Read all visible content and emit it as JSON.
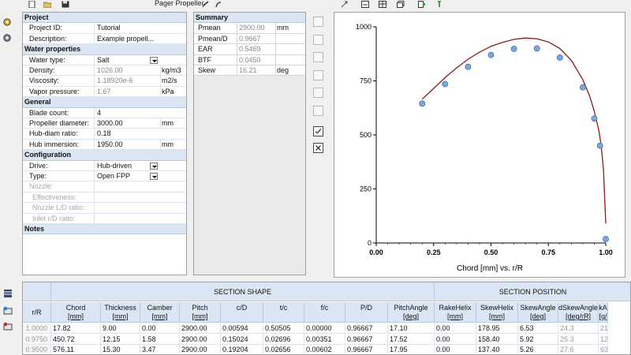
{
  "toolbar": {
    "title": "Pager Propeller",
    "icons": [
      "new-file-icon",
      "open-folder-icon",
      "save-icon",
      "undo-icon",
      "redo-icon",
      "report-icon",
      "table-icon",
      "copy-icon",
      "export-icon",
      "help-icon"
    ]
  },
  "left_rail": [
    "settings-gear-icon",
    "settings-gear-icon-2"
  ],
  "project": {
    "section_project": "Project",
    "project_id_label": "Project ID:",
    "project_id": "Tutorial",
    "description_label": "Description:",
    "description": "Example propell...",
    "section_water": "Water properties",
    "water_type_label": "Water type:",
    "water_type": "Salt",
    "density_label": "Density:",
    "density": "1026.00",
    "density_unit": "kg/m3",
    "viscosity_label": "Viscosity:",
    "viscosity": "1.18920e-6",
    "viscosity_unit": "m2/s",
    "vapor_label": "Vapor pressure:",
    "vapor": "1.67",
    "vapor_unit": "kPa",
    "section_general": "General",
    "blade_label": "Blade count:",
    "blade": "4",
    "diameter_label": "Propeller diameter:",
    "diameter": "3000.00",
    "diameter_unit": "mm",
    "hub_ratio_label": "Hub-diam ratio:",
    "hub_ratio": "0.18",
    "hub_imm_label": "Hub immersion:",
    "hub_imm": "1950.00",
    "hub_imm_unit": "mm",
    "section_config": "Configuration",
    "drive_label": "Drive:",
    "drive": "Hub-driven",
    "type_label": "Type:",
    "type": "Open FPP",
    "nozzle_label": "Nozzle:",
    "effectiveness_label": "Effectiveness:",
    "nozzle_ld_label": "Nozzle L/D ratio:",
    "inlet_label": "Inlet r/D ratio:",
    "section_notes": "Notes"
  },
  "summary": {
    "title": "Summary",
    "rows": [
      {
        "label": "Pmean",
        "value": "2900.00",
        "unit": "mm"
      },
      {
        "label": "Pmean/D",
        "value": "0.9667",
        "unit": ""
      },
      {
        "label": "EAR",
        "value": "0.5469",
        "unit": ""
      },
      {
        "label": "BTF",
        "value": "0.0450",
        "unit": ""
      },
      {
        "label": "Skew",
        "value": "16.21",
        "unit": "deg"
      }
    ]
  },
  "side_buttons": [
    "expand-icon",
    "expand-icon-2",
    "expand-icon-3",
    "expand-icon-4",
    "formula-icon",
    "formula-icon-2",
    "checkbox-checked-icon",
    "checkbox-x-icon"
  ],
  "chart_data": {
    "type": "scatter",
    "xlabel": "Chord [mm] vs. r/R",
    "ylabel": "",
    "xlim": [
      0.0,
      1.0
    ],
    "ylim": [
      0,
      1000
    ],
    "xticks": [
      "0.00",
      "0.25",
      "0.50",
      "0.75",
      "1.00"
    ],
    "yticks": [
      "0",
      "250",
      "500",
      "750",
      "1000"
    ],
    "series": [
      {
        "kind": "points",
        "x": [
          0.2,
          0.3,
          0.4,
          0.5,
          0.6,
          0.7,
          0.8,
          0.9,
          0.95,
          0.975,
          1.0
        ],
        "y": [
          645,
          735,
          815,
          870,
          898,
          900,
          858,
          720,
          576,
          450,
          18
        ]
      },
      {
        "kind": "curve",
        "x": [
          0.2,
          0.25,
          0.3,
          0.35,
          0.4,
          0.45,
          0.5,
          0.55,
          0.6,
          0.65,
          0.7,
          0.75,
          0.8,
          0.85,
          0.9,
          0.93,
          0.95,
          0.97,
          0.98,
          0.99,
          1.0
        ],
        "y": [
          665,
          715,
          765,
          810,
          850,
          883,
          910,
          928,
          942,
          948,
          945,
          930,
          900,
          845,
          755,
          680,
          610,
          520,
          450,
          340,
          90
        ]
      }
    ],
    "colors": {
      "points": "#7fa6d8",
      "curve": "#8b1a1a"
    }
  },
  "table": {
    "group_section_shape": "SECTION SHAPE",
    "group_section_position": "SECTION POSITION",
    "rR_header": "r/R",
    "headers": [
      {
        "t": "Chord",
        "u": "[mm]"
      },
      {
        "t": "Thickness",
        "u": "[mm]"
      },
      {
        "t": "Camber",
        "u": "[mm]"
      },
      {
        "t": "Pitch",
        "u": "[mm]"
      },
      {
        "t": "c/D",
        "u": ""
      },
      {
        "t": "t/c",
        "u": ""
      },
      {
        "t": "f/c",
        "u": ""
      },
      {
        "t": "P/D",
        "u": ""
      },
      {
        "t": "PitchAngle",
        "u": "[deg]"
      },
      {
        "t": "RakeHelix",
        "u": "[mm]"
      },
      {
        "t": "SkewHelix",
        "u": "[mm]"
      },
      {
        "t": "SkewAngle",
        "u": "[deg]"
      },
      {
        "t": "dSkewAngle",
        "u": "[deg/rR]"
      },
      {
        "t": "kA",
        "u": "[q/"
      }
    ],
    "rows": [
      [
        "1.0000",
        "17.82",
        "9.00",
        "0.00",
        "2900.00",
        "0.00594",
        "0.50505",
        "0.00000",
        "0.96667",
        "17.10",
        "0.00",
        "178.95",
        "6.53",
        "24.3",
        "21"
      ],
      [
        "0.9750",
        "450.72",
        "12.15",
        "1.58",
        "2900.00",
        "0.15024",
        "0.02696",
        "0.00351",
        "0.96667",
        "17.52",
        "0.00",
        "158.40",
        "5.92",
        "25.3",
        "12"
      ],
      [
        "0.9500",
        "576.11",
        "15.30",
        "3.47",
        "2900.00",
        "0.19204",
        "0.02656",
        "0.00602",
        "0.96667",
        "17.95",
        "0.00",
        "137.40",
        "5.26",
        "27.6",
        "63"
      ]
    ]
  },
  "bottom_rail": [
    "sections-icon",
    "add-row-icon",
    "delete-row-icon"
  ]
}
